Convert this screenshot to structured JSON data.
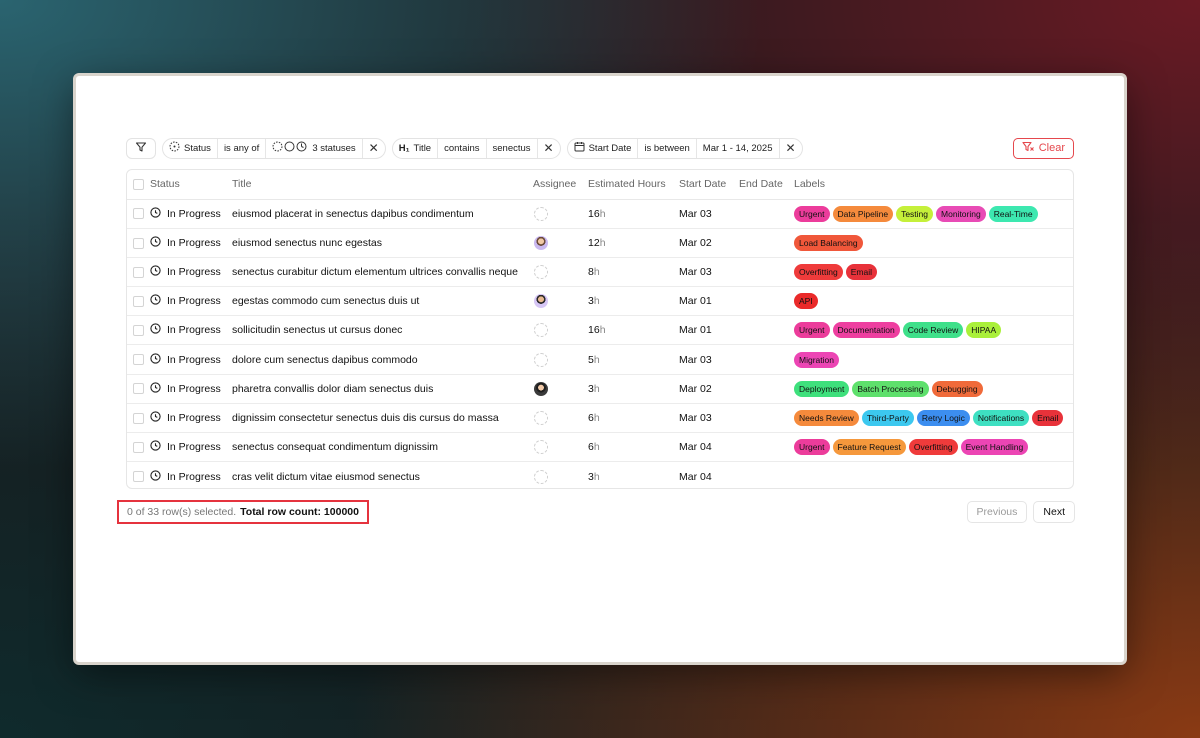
{
  "toolbar": {
    "filters": [
      {
        "field": "Status",
        "operator": "is any of",
        "value": "3 statuses"
      },
      {
        "field": "Title",
        "field_prefix": "H₁",
        "operator": "contains",
        "value": "senectus"
      },
      {
        "field": "Start Date",
        "operator": "is between",
        "value": "Mar 1 - 14, 2025"
      }
    ],
    "clear_label": "Clear"
  },
  "table": {
    "columns": [
      "Status",
      "Title",
      "Assignee",
      "Estimated Hours",
      "Start Date",
      "End Date",
      "Labels"
    ],
    "hours_unit": "h",
    "rows": [
      {
        "status": "In Progress",
        "title": "eiusmod placerat in senectus dapibus condimentum",
        "assignee": "none",
        "hours": "16",
        "start": "Mar 03",
        "end": "",
        "labels": [
          "Urgent",
          "Data Pipeline",
          "Testing",
          "Monitoring",
          "Real-Time"
        ]
      },
      {
        "status": "In Progress",
        "title": "eiusmod senectus nunc egestas",
        "assignee": "a1",
        "hours": "12",
        "start": "Mar 02",
        "end": "",
        "labels": [
          "Load Balancing"
        ]
      },
      {
        "status": "In Progress",
        "title": "senectus curabitur dictum elementum ultrices convallis neque",
        "assignee": "none",
        "hours": "8",
        "start": "Mar 03",
        "end": "",
        "labels": [
          "Overfitting",
          "Email"
        ]
      },
      {
        "status": "In Progress",
        "title": "egestas commodo cum senectus duis ut",
        "assignee": "a2",
        "hours": "3",
        "start": "Mar 01",
        "end": "",
        "labels": [
          "API"
        ]
      },
      {
        "status": "In Progress",
        "title": "sollicitudin senectus ut cursus donec",
        "assignee": "none",
        "hours": "16",
        "start": "Mar 01",
        "end": "",
        "labels": [
          "Urgent",
          "Documentation",
          "Code Review",
          "HIPAA"
        ]
      },
      {
        "status": "In Progress",
        "title": "dolore cum senectus dapibus commodo",
        "assignee": "none",
        "hours": "5",
        "start": "Mar 03",
        "end": "",
        "labels": [
          "Migration"
        ]
      },
      {
        "status": "In Progress",
        "title": "pharetra convallis dolor diam senectus duis",
        "assignee": "a3",
        "hours": "3",
        "start": "Mar 02",
        "end": "",
        "labels": [
          "Deployment",
          "Batch Processing",
          "Debugging"
        ]
      },
      {
        "status": "In Progress",
        "title": "dignissim consectetur senectus duis dis cursus do massa",
        "assignee": "none",
        "hours": "6",
        "start": "Mar 03",
        "end": "",
        "labels": [
          "Needs Review",
          "Third-Party",
          "Retry Logic",
          "Notifications",
          "Email"
        ]
      },
      {
        "status": "In Progress",
        "title": "senectus consequat condimentum dignissim",
        "assignee": "none",
        "hours": "6",
        "start": "Mar 04",
        "end": "",
        "labels": [
          "Urgent",
          "Feature Request",
          "Overfitting",
          "Event Handling"
        ]
      },
      {
        "status": "In Progress",
        "title": "cras velit dictum vitae eiusmod senectus",
        "assignee": "none",
        "hours": "3",
        "start": "Mar 04",
        "end": "",
        "labels": []
      }
    ]
  },
  "label_colors": {
    "Urgent": "#ec3c9b",
    "Data Pipeline": "#f58a3c",
    "Testing": "#c5f03a",
    "Monitoring": "#e84bb5",
    "Real-Time": "#3de8b0",
    "Load Balancing": "#f0573a",
    "Overfitting": "#ef3b3b",
    "Email": "#e8323a",
    "API": "#ea2a2a",
    "Documentation": "#ee3fa0",
    "Code Review": "#3ee08a",
    "HIPAA": "#aaf03a",
    "Migration": "#ec45b4",
    "Deployment": "#3ee07c",
    "Batch Processing": "#5ee06c",
    "Debugging": "#f06a3a",
    "Needs Review": "#f58a3c",
    "Third-Party": "#3cc8ef",
    "Retry Logic": "#3c8ef0",
    "Notifications": "#3ee0c2",
    "Feature Request": "#f5983c",
    "Event Handling": "#ec45b4"
  },
  "footer": {
    "selection_text": "0 of 33 row(s) selected.",
    "total_label": "Total row count: 100000",
    "prev_label": "Previous",
    "next_label": "Next"
  }
}
